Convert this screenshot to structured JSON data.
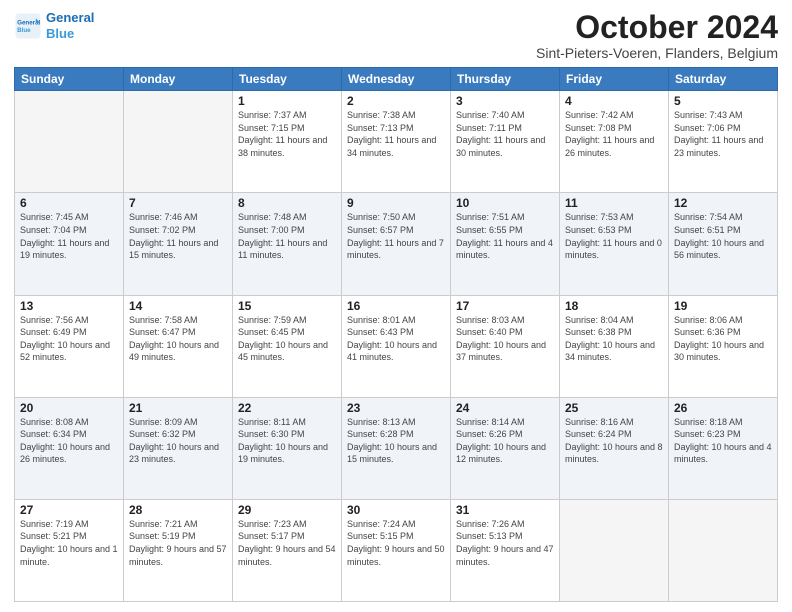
{
  "header": {
    "logo_general": "General",
    "logo_blue": "Blue",
    "month_title": "October 2024",
    "location": "Sint-Pieters-Voeren, Flanders, Belgium"
  },
  "days_of_week": [
    "Sunday",
    "Monday",
    "Tuesday",
    "Wednesday",
    "Thursday",
    "Friday",
    "Saturday"
  ],
  "weeks": [
    [
      {
        "day": "",
        "sunrise": "",
        "sunset": "",
        "daylight": ""
      },
      {
        "day": "",
        "sunrise": "",
        "sunset": "",
        "daylight": ""
      },
      {
        "day": "1",
        "sunrise": "Sunrise: 7:37 AM",
        "sunset": "Sunset: 7:15 PM",
        "daylight": "Daylight: 11 hours and 38 minutes."
      },
      {
        "day": "2",
        "sunrise": "Sunrise: 7:38 AM",
        "sunset": "Sunset: 7:13 PM",
        "daylight": "Daylight: 11 hours and 34 minutes."
      },
      {
        "day": "3",
        "sunrise": "Sunrise: 7:40 AM",
        "sunset": "Sunset: 7:11 PM",
        "daylight": "Daylight: 11 hours and 30 minutes."
      },
      {
        "day": "4",
        "sunrise": "Sunrise: 7:42 AM",
        "sunset": "Sunset: 7:08 PM",
        "daylight": "Daylight: 11 hours and 26 minutes."
      },
      {
        "day": "5",
        "sunrise": "Sunrise: 7:43 AM",
        "sunset": "Sunset: 7:06 PM",
        "daylight": "Daylight: 11 hours and 23 minutes."
      }
    ],
    [
      {
        "day": "6",
        "sunrise": "Sunrise: 7:45 AM",
        "sunset": "Sunset: 7:04 PM",
        "daylight": "Daylight: 11 hours and 19 minutes."
      },
      {
        "day": "7",
        "sunrise": "Sunrise: 7:46 AM",
        "sunset": "Sunset: 7:02 PM",
        "daylight": "Daylight: 11 hours and 15 minutes."
      },
      {
        "day": "8",
        "sunrise": "Sunrise: 7:48 AM",
        "sunset": "Sunset: 7:00 PM",
        "daylight": "Daylight: 11 hours and 11 minutes."
      },
      {
        "day": "9",
        "sunrise": "Sunrise: 7:50 AM",
        "sunset": "Sunset: 6:57 PM",
        "daylight": "Daylight: 11 hours and 7 minutes."
      },
      {
        "day": "10",
        "sunrise": "Sunrise: 7:51 AM",
        "sunset": "Sunset: 6:55 PM",
        "daylight": "Daylight: 11 hours and 4 minutes."
      },
      {
        "day": "11",
        "sunrise": "Sunrise: 7:53 AM",
        "sunset": "Sunset: 6:53 PM",
        "daylight": "Daylight: 11 hours and 0 minutes."
      },
      {
        "day": "12",
        "sunrise": "Sunrise: 7:54 AM",
        "sunset": "Sunset: 6:51 PM",
        "daylight": "Daylight: 10 hours and 56 minutes."
      }
    ],
    [
      {
        "day": "13",
        "sunrise": "Sunrise: 7:56 AM",
        "sunset": "Sunset: 6:49 PM",
        "daylight": "Daylight: 10 hours and 52 minutes."
      },
      {
        "day": "14",
        "sunrise": "Sunrise: 7:58 AM",
        "sunset": "Sunset: 6:47 PM",
        "daylight": "Daylight: 10 hours and 49 minutes."
      },
      {
        "day": "15",
        "sunrise": "Sunrise: 7:59 AM",
        "sunset": "Sunset: 6:45 PM",
        "daylight": "Daylight: 10 hours and 45 minutes."
      },
      {
        "day": "16",
        "sunrise": "Sunrise: 8:01 AM",
        "sunset": "Sunset: 6:43 PM",
        "daylight": "Daylight: 10 hours and 41 minutes."
      },
      {
        "day": "17",
        "sunrise": "Sunrise: 8:03 AM",
        "sunset": "Sunset: 6:40 PM",
        "daylight": "Daylight: 10 hours and 37 minutes."
      },
      {
        "day": "18",
        "sunrise": "Sunrise: 8:04 AM",
        "sunset": "Sunset: 6:38 PM",
        "daylight": "Daylight: 10 hours and 34 minutes."
      },
      {
        "day": "19",
        "sunrise": "Sunrise: 8:06 AM",
        "sunset": "Sunset: 6:36 PM",
        "daylight": "Daylight: 10 hours and 30 minutes."
      }
    ],
    [
      {
        "day": "20",
        "sunrise": "Sunrise: 8:08 AM",
        "sunset": "Sunset: 6:34 PM",
        "daylight": "Daylight: 10 hours and 26 minutes."
      },
      {
        "day": "21",
        "sunrise": "Sunrise: 8:09 AM",
        "sunset": "Sunset: 6:32 PM",
        "daylight": "Daylight: 10 hours and 23 minutes."
      },
      {
        "day": "22",
        "sunrise": "Sunrise: 8:11 AM",
        "sunset": "Sunset: 6:30 PM",
        "daylight": "Daylight: 10 hours and 19 minutes."
      },
      {
        "day": "23",
        "sunrise": "Sunrise: 8:13 AM",
        "sunset": "Sunset: 6:28 PM",
        "daylight": "Daylight: 10 hours and 15 minutes."
      },
      {
        "day": "24",
        "sunrise": "Sunrise: 8:14 AM",
        "sunset": "Sunset: 6:26 PM",
        "daylight": "Daylight: 10 hours and 12 minutes."
      },
      {
        "day": "25",
        "sunrise": "Sunrise: 8:16 AM",
        "sunset": "Sunset: 6:24 PM",
        "daylight": "Daylight: 10 hours and 8 minutes."
      },
      {
        "day": "26",
        "sunrise": "Sunrise: 8:18 AM",
        "sunset": "Sunset: 6:23 PM",
        "daylight": "Daylight: 10 hours and 4 minutes."
      }
    ],
    [
      {
        "day": "27",
        "sunrise": "Sunrise: 7:19 AM",
        "sunset": "Sunset: 5:21 PM",
        "daylight": "Daylight: 10 hours and 1 minute."
      },
      {
        "day": "28",
        "sunrise": "Sunrise: 7:21 AM",
        "sunset": "Sunset: 5:19 PM",
        "daylight": "Daylight: 9 hours and 57 minutes."
      },
      {
        "day": "29",
        "sunrise": "Sunrise: 7:23 AM",
        "sunset": "Sunset: 5:17 PM",
        "daylight": "Daylight: 9 hours and 54 minutes."
      },
      {
        "day": "30",
        "sunrise": "Sunrise: 7:24 AM",
        "sunset": "Sunset: 5:15 PM",
        "daylight": "Daylight: 9 hours and 50 minutes."
      },
      {
        "day": "31",
        "sunrise": "Sunrise: 7:26 AM",
        "sunset": "Sunset: 5:13 PM",
        "daylight": "Daylight: 9 hours and 47 minutes."
      },
      {
        "day": "",
        "sunrise": "",
        "sunset": "",
        "daylight": ""
      },
      {
        "day": "",
        "sunrise": "",
        "sunset": "",
        "daylight": ""
      }
    ]
  ]
}
